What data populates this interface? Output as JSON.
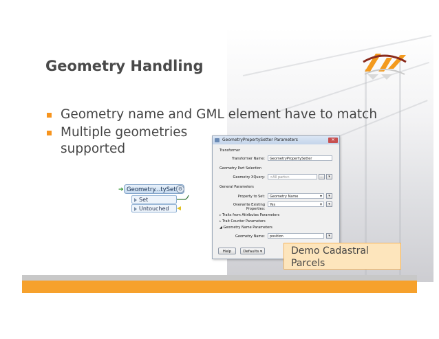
{
  "slide": {
    "title": "Geometry Handling",
    "bullets": [
      "Geometry name and GML element have to match",
      "Multiple geometries supported"
    ],
    "callout": "Demo Cadastral Parcels"
  },
  "transformer": {
    "name": "Geometry...tySetter",
    "ports": [
      "Set",
      "Untouched"
    ]
  },
  "dialog": {
    "title": "GeometryPropertySetter Parameters",
    "sections": {
      "transformer": "Transformer",
      "part_selection": "Geometry Part Selection",
      "general": "General Parameters"
    },
    "fields": {
      "transformer_name_label": "Transformer Name:",
      "transformer_name_value": "GeometryPropertySetter",
      "xquery_label": "Geometry XQuery:",
      "xquery_placeholder": "<All parts>",
      "property_label": "Property to Set:",
      "property_value": "Geometry Name",
      "overwrite_label": "Overwrite Existing Properties:",
      "overwrite_value": "Yes",
      "geomname_label": "Geometry Name:",
      "geomname_value": "position"
    },
    "groups": [
      "Traits from Attributes Parameters",
      "Trait Counter Parameters",
      "Geometry Name Parameters"
    ],
    "buttons": {
      "help": "Help",
      "defaults": "Defaults",
      "browse": "..."
    }
  },
  "colors": {
    "accent": "#f7941d",
    "band_orange": "#f6a12c",
    "band_gray": "#c8c8c8",
    "callout_fill": "#fde5bc"
  }
}
